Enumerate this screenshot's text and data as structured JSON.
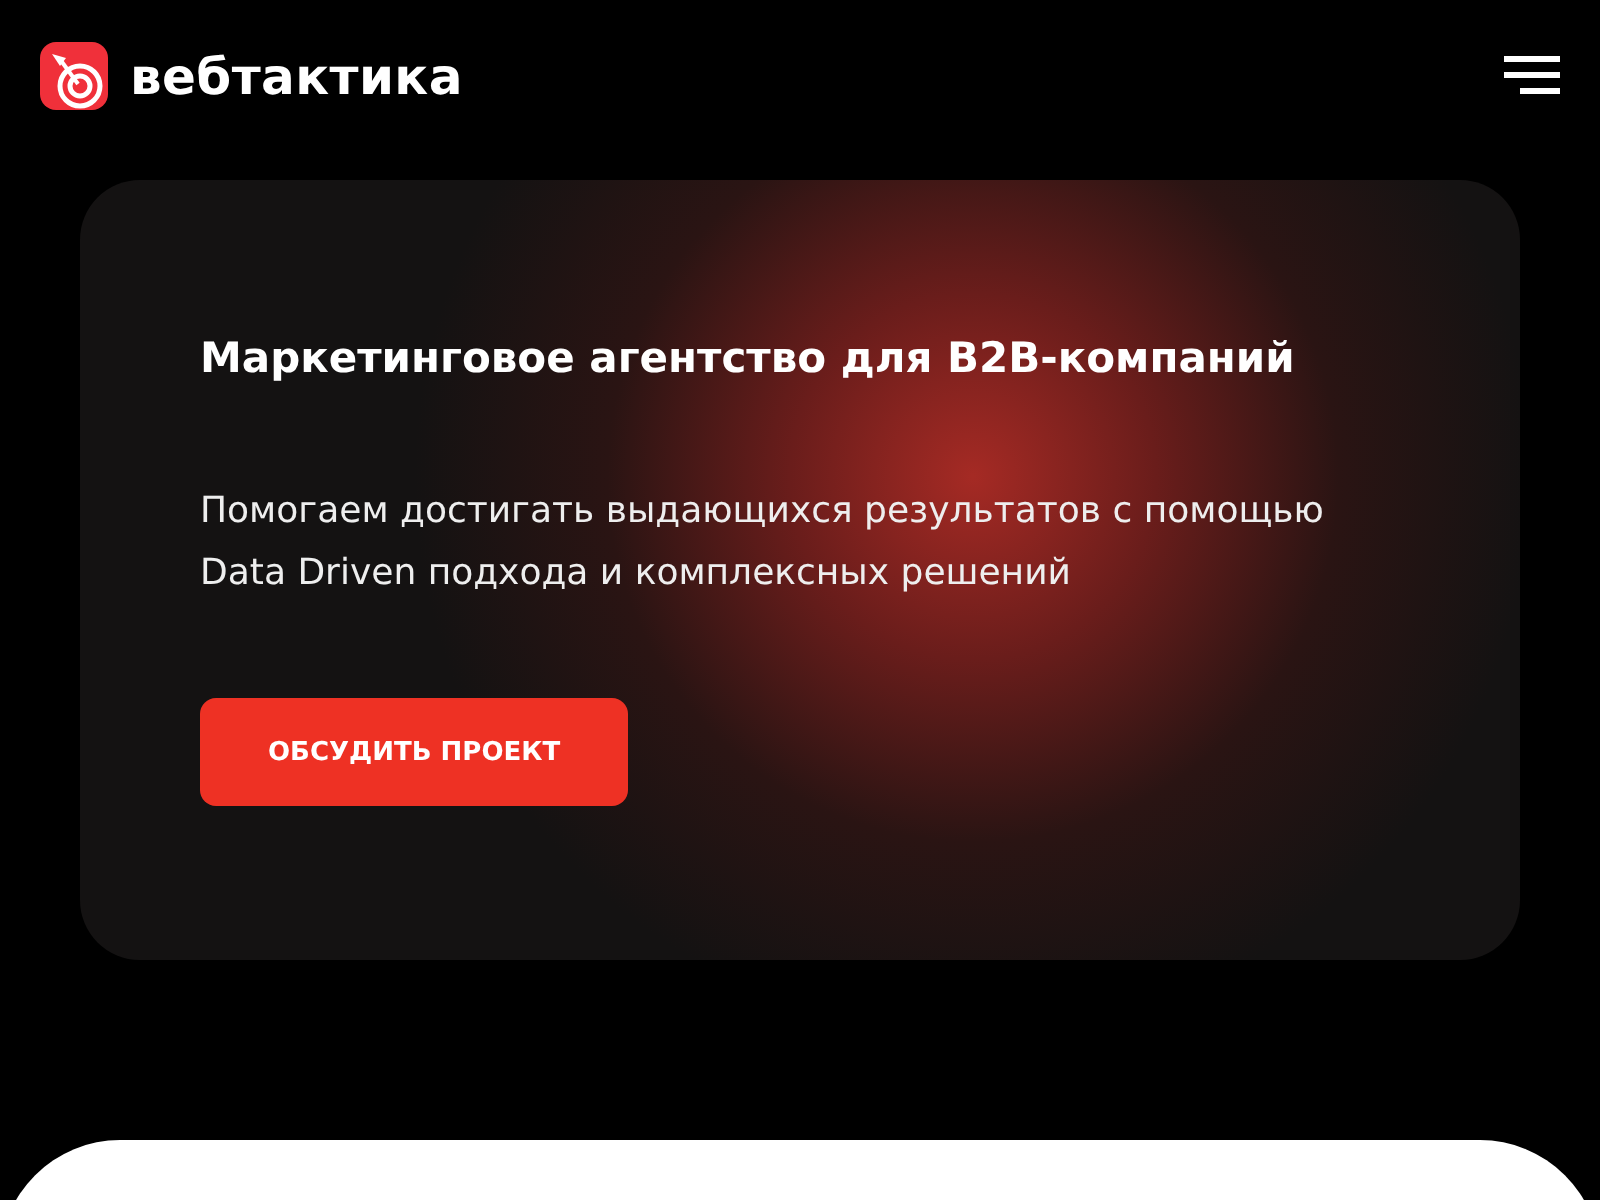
{
  "header": {
    "logo_text": "вебтактика"
  },
  "hero": {
    "title": "Маркетинговое агентство для B2B-компаний",
    "text": "Помогаем достигать выдающихся результатов с помощью Data Driven подхода и комплексных решений",
    "button": "ОБСУДИТЬ ПРОЕКТ"
  }
}
